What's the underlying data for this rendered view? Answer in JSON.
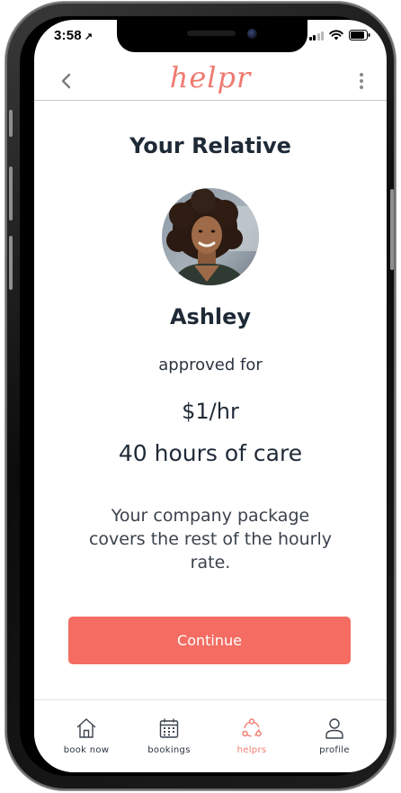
{
  "status_bar": {
    "time": "3:58",
    "location_arrow": "↗"
  },
  "header": {
    "logo": "helpr",
    "back_icon": "chevron-left-icon",
    "menu_icon": "more-vertical-icon"
  },
  "content": {
    "title": "Your Relative",
    "name": "Ashley",
    "approved_text": "approved for",
    "rate": "$1/hr",
    "hours": "40 hours of care",
    "description": "Your company package covers the rest of the hourly rate.",
    "continue_label": "Continue"
  },
  "tabs": [
    {
      "label": "book now",
      "icon": "home-icon",
      "active": false
    },
    {
      "label": "bookings",
      "icon": "calendar-icon",
      "active": false
    },
    {
      "label": "helprs",
      "icon": "helprs-network-icon",
      "active": true
    },
    {
      "label": "profile",
      "icon": "user-icon",
      "active": false
    }
  ],
  "colors": {
    "brand": "#f07a70",
    "button": "#f46c62",
    "text_dark": "#1f2a37"
  }
}
